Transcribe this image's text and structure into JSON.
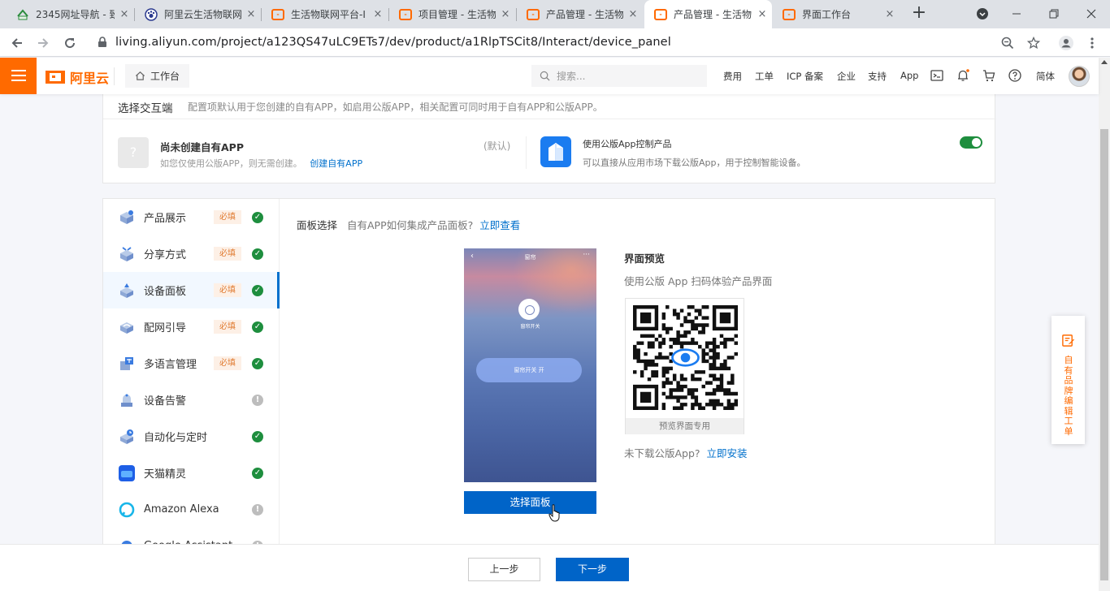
{
  "browser": {
    "tabs": [
      {
        "title": "2345网址导航 - 致",
        "favicon": "2345-favicon"
      },
      {
        "title": "阿里云生活物联网",
        "favicon": "paw-favicon"
      },
      {
        "title": "生活物联网平台-I",
        "favicon": "aliyun-favicon"
      },
      {
        "title": "项目管理 - 生活物",
        "favicon": "aliyun-favicon"
      },
      {
        "title": "产品管理 - 生活物",
        "favicon": "aliyun-favicon"
      },
      {
        "title": "产品管理 - 生活物",
        "favicon": "aliyun-favicon",
        "active": true
      },
      {
        "title": "界面工作台",
        "favicon": "aliyun-favicon"
      }
    ],
    "close_glyph": "×",
    "new_tab_glyph": "+",
    "url": "living.aliyun.com/project/a123QS47uLC9ETs7/dev/product/a1RlpTSCit8/Interact/device_panel"
  },
  "header": {
    "logo_text": "阿里云",
    "workbench_label": "工作台",
    "search_placeholder": "搜索...",
    "nav": [
      "费用",
      "工单",
      "ICP 备案",
      "企业",
      "支持",
      "App"
    ],
    "lang": "简体",
    "brand_color": "#ff6a00"
  },
  "interaction": {
    "title": "选择交互端",
    "desc": "配置项默认用于您创建的自有APP，如启用公版APP，相关配置可同时用于自有APP和公版APP。",
    "own_app": {
      "icon_glyph": "?",
      "title": "尚未创建自有APP",
      "desc": "如您仅使用公版APP，则无需创建。",
      "link": "创建自有APP",
      "default_tag": "(默认)"
    },
    "public_app": {
      "title": "使用公版App控制产品",
      "desc": "可以直接从应用市场下载公版App，用于控制智能设备。",
      "enabled": true
    }
  },
  "menu": {
    "items": [
      {
        "label": "产品展示",
        "badge": "必填",
        "status": "ok",
        "icon": "box-icon"
      },
      {
        "label": "分享方式",
        "badge": "必填",
        "status": "ok",
        "icon": "share-icon"
      },
      {
        "label": "设备面板",
        "badge": "必填",
        "status": "ok",
        "icon": "panel-icon",
        "active": true
      },
      {
        "label": "配网引导",
        "badge": "必填",
        "status": "ok",
        "icon": "network-guide-icon"
      },
      {
        "label": "多语言管理",
        "badge": "必填",
        "status": "ok",
        "icon": "language-icon"
      },
      {
        "label": "设备告警",
        "badge": "",
        "status": "warn",
        "icon": "alarm-icon"
      },
      {
        "label": "自动化与定时",
        "badge": "",
        "status": "ok",
        "icon": "automation-icon"
      },
      {
        "label": "天猫精灵",
        "badge": "",
        "status": "ok",
        "icon": "tmall-genie-icon"
      },
      {
        "label": "Amazon Alexa",
        "badge": "",
        "status": "warn",
        "icon": "alexa-icon"
      },
      {
        "label": "Google Assistant",
        "badge": "",
        "status": "warn",
        "icon": "google-assistant-icon"
      }
    ],
    "ok_glyph": "✓",
    "warn_glyph": "!"
  },
  "panel": {
    "title": "面板选择",
    "question": "自有APP如何集成产品面板?",
    "question_link": "立即查看",
    "phone": {
      "header": "窗帘",
      "device_label": "窗帘开关",
      "pill_text": "窗帘开关    开",
      "back_glyph": "‹",
      "more_glyph": "···"
    },
    "choose_button": "选择面板",
    "preview": {
      "title": "界面预览",
      "desc": "使用公版 App 扫码体验产品界面",
      "qr_caption": "预览界面专用",
      "install_question": "未下载公版App?",
      "install_link": "立即安装"
    }
  },
  "side_tab": {
    "label": "自有品牌编辑工单"
  },
  "footer": {
    "prev": "上一步",
    "next": "下一步",
    "primary_color": "#0064c8"
  }
}
